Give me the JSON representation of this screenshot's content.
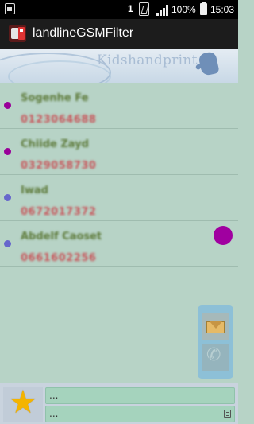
{
  "status_bar": {
    "sim_label": "1",
    "battery_percent": "100%",
    "time": "15:03"
  },
  "app_bar": {
    "title": "landlineGSMFilter",
    "icon": "phone-filter-app-icon"
  },
  "banner": {
    "brand_text": "Kidshandprint",
    "icon": "hand-icon"
  },
  "contacts": [
    {
      "name": "Sogenhe Fe",
      "number": "0123064688",
      "dot_color": "#990099"
    },
    {
      "name": "Chiide Zayd",
      "number": "0329058730",
      "dot_color": "#990099"
    },
    {
      "name": "Iwad",
      "number": "0672017372",
      "dot_color": "#6666cc"
    },
    {
      "name": "Abdelf Caoset",
      "number": "0661602256",
      "dot_color": "#6666cc"
    }
  ],
  "floating_dot_color": "#a000a0",
  "side_actions": {
    "sms_icon": "envelope-icon",
    "call_icon": "phone-icon"
  },
  "bottom_bar": {
    "favorite_icon": "star-icon",
    "field_top": "...",
    "field_bottom": "...",
    "edit_icon": "clipboard-icon"
  },
  "colors": {
    "name_text": "#5d7a3a",
    "number_text": "#c8555a",
    "list_background": "#b7d3c6",
    "star": "#f4b400"
  }
}
